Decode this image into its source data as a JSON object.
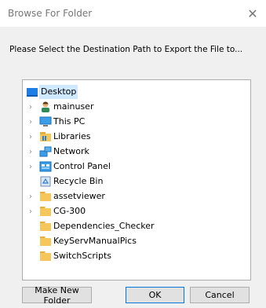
{
  "window": {
    "title": "Browse For Folder",
    "close_glyph": "✕"
  },
  "prompt": "Please Select the Destination Path to Export the File to...",
  "tree": {
    "items": [
      {
        "label": "Desktop",
        "icon": "desktop-icon",
        "expandable": false,
        "selected": true
      },
      {
        "label": "mainuser",
        "icon": "user-icon",
        "expandable": true
      },
      {
        "label": "This PC",
        "icon": "computer-icon",
        "expandable": true
      },
      {
        "label": "Libraries",
        "icon": "library-icon",
        "expandable": true
      },
      {
        "label": "Network",
        "icon": "network-icon",
        "expandable": true
      },
      {
        "label": "Control Panel",
        "icon": "control-panel-icon",
        "expandable": true
      },
      {
        "label": "Recycle Bin",
        "icon": "recycle-bin-icon",
        "expandable": false
      },
      {
        "label": "assetviewer",
        "icon": "folder-icon",
        "expandable": true
      },
      {
        "label": "CG-300",
        "icon": "folder-icon",
        "expandable": true
      },
      {
        "label": "Dependencies_Checker",
        "icon": "folder-icon",
        "expandable": false
      },
      {
        "label": "KeyServManualPics",
        "icon": "folder-icon",
        "expandable": false
      },
      {
        "label": "SwitchScripts",
        "icon": "folder-icon",
        "expandable": false
      }
    ],
    "chevron_glyph": "›"
  },
  "buttons": {
    "new_folder": "Make New Folder",
    "ok": "OK",
    "cancel": "Cancel"
  },
  "colors": {
    "selection": "#cde8ff",
    "folder": "#f6c65b",
    "accent": "#0078d7"
  }
}
